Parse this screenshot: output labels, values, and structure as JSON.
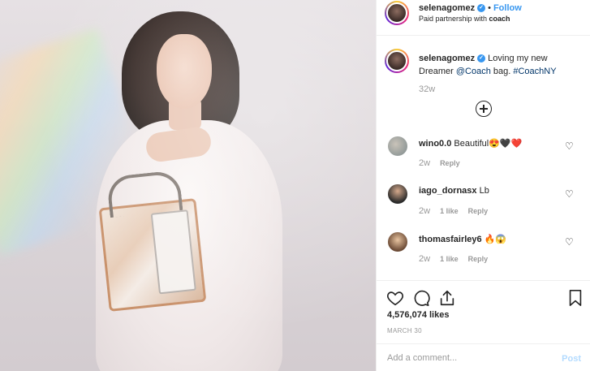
{
  "post": {
    "author": "selenagomez",
    "follow_label": "Follow",
    "dot": "•",
    "partnership_prefix": "Paid partnership with ",
    "partner": "coach",
    "caption_user": "selenagomez",
    "caption_text": " Loving my new Dreamer ",
    "caption_mention": "@Coach",
    "caption_mid": " bag. ",
    "caption_hashtag": "#CoachNY",
    "caption_time": "32w",
    "likes": "4,576,074 likes",
    "date": "MARCH 30"
  },
  "comments": [
    {
      "user": "wino0.0",
      "text": " Beautiful😍🖤❤️",
      "time": "2w",
      "likes": "",
      "reply": "Reply"
    },
    {
      "user": "iago_dornasx",
      "text": " Lb",
      "time": "2w",
      "likes": "1 like",
      "reply": "Reply"
    },
    {
      "user": "thomasfairley6",
      "text": " 🔥😱",
      "time": "2w",
      "likes": "1 like",
      "reply": "Reply"
    }
  ],
  "icons": {
    "verified": "verified-badge-icon",
    "like": "heart-icon",
    "comment": "comment-bubble-icon",
    "share": "share-icon",
    "save": "bookmark-icon",
    "load_more": "plus-circle-icon"
  },
  "add_comment": {
    "placeholder": "Add a comment...",
    "post_label": "Post"
  },
  "colors": {
    "link": "#3897f0",
    "muted": "#999999",
    "text": "#262626",
    "border": "#efefef"
  }
}
